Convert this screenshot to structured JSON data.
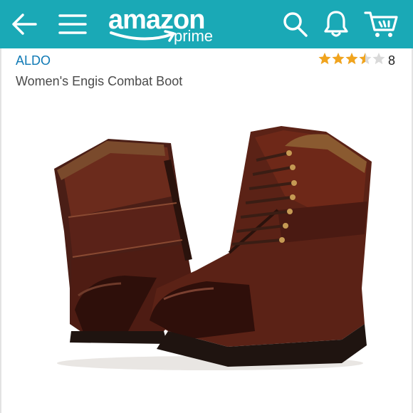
{
  "header": {
    "logo_word": "amazon",
    "logo_sub": "prime",
    "accent": "#1aa9b6",
    "icons": [
      "back-arrow-icon",
      "hamburger-menu-icon",
      "search-icon",
      "bell-icon",
      "cart-icon"
    ]
  },
  "product": {
    "brand": "ALDO",
    "title": "Women's Engis Combat Boot",
    "rating": 3.5,
    "rating_max": 5,
    "review_count": "8",
    "image": "brown-leather-combat-boot-pair"
  }
}
